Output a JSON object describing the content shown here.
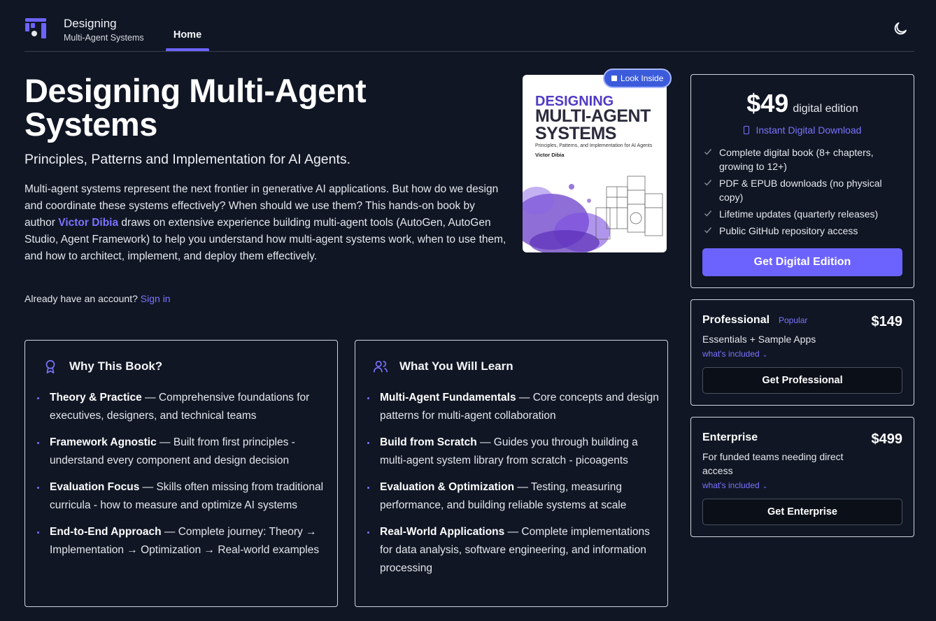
{
  "header": {
    "brand_title": "Designing",
    "brand_subtitle": "Multi-Agent Systems",
    "nav_home": "Home",
    "theme_icon": "moon-icon",
    "logo_icon": "book-logo-icon"
  },
  "hero": {
    "title": "Designing Multi-Agent Systems",
    "subtitle": "Principles, Patterns and Implementation for AI Agents.",
    "desc_before": "Multi-agent systems represent the next frontier in generative AI applications. But how do we design and coordinate these systems effectively? When should we use them? This hands-on book by author ",
    "author": "Victor Dibia",
    "desc_after": " draws on extensive experience building multi-agent tools (AutoGen, AutoGen Studio, Agent Framework) to help you understand how multi-agent systems work, when to use them, and how to architect, implement, and deploy them effectively.",
    "account_prompt": "Already have an account?",
    "sign_in": "Sign in"
  },
  "cover": {
    "title_line1": "DESIGNING",
    "title_line2": "MULTI-AGENT",
    "title_line3": "SYSTEMS",
    "subtitle": "Principles, Patterns, and Implementation for AI Agents",
    "author": "Victor Dibia",
    "look_inside": "Look Inside"
  },
  "why": {
    "title": "Why This Book?",
    "icon": "award-ribbon-icon",
    "items": [
      {
        "bold": "Theory & Practice",
        "text": " — Comprehensive foundations for executives, designers, and technical teams"
      },
      {
        "bold": "Framework Agnostic",
        "text": " — Built from first principles - understand every component and design decision"
      },
      {
        "bold": "Evaluation Focus",
        "text": " — Skills often missing from traditional curricula - how to measure and optimize AI systems"
      },
      {
        "bold": "End-to-End Approach",
        "text": " — Complete journey: Theory → Implementation → Optimization → Real-world examples"
      }
    ]
  },
  "learn": {
    "title": "What You Will Learn",
    "icon": "users-icon",
    "items": [
      {
        "bold": "Multi-Agent Fundamentals",
        "text": " — Core concepts and design patterns for multi-agent collaboration"
      },
      {
        "bold": "Build from Scratch",
        "text": " — Guides you through building a multi-agent system library from scratch - picoagents"
      },
      {
        "bold": "Evaluation & Optimization",
        "text": " — Testing, measuring performance, and building reliable systems at scale"
      },
      {
        "bold": "Real-World Applications",
        "text": " — Complete implementations for data analysis, software engineering, and information processing"
      }
    ]
  },
  "pricing": {
    "digital": {
      "price": "$49",
      "edition": "digital edition",
      "instant": "Instant Digital Download",
      "features": [
        "Complete digital book (8+ chapters, growing to 12+)",
        "PDF & EPUB downloads (no physical copy)",
        "Lifetime updates (quarterly releases)",
        "Public GitHub repository access"
      ],
      "button": "Get Digital Edition"
    },
    "professional": {
      "name": "Professional",
      "badge": "Popular",
      "price": "$149",
      "desc": "Essentials + Sample Apps",
      "more": "what's included",
      "button": "Get Professional"
    },
    "enterprise": {
      "name": "Enterprise",
      "price": "$499",
      "desc": "For funded teams needing direct access",
      "more": "what's included",
      "button": "Get Enterprise"
    }
  },
  "colors": {
    "background": "#101624",
    "accent": "#6c63ff",
    "link": "#7b73ff"
  }
}
